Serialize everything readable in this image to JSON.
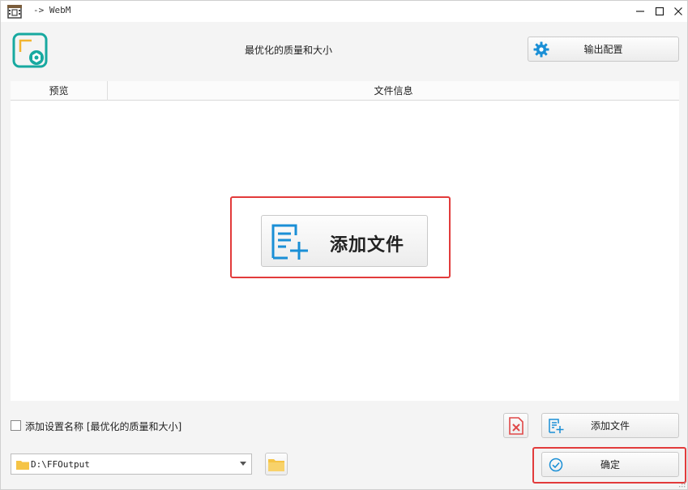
{
  "window": {
    "title": "-> WebM",
    "controls": {
      "minimize": "—",
      "maximize": "☐",
      "close": "✕"
    }
  },
  "header": {
    "preset_name": "最优化的质量和大小",
    "output_button_label": "输出配置",
    "output_button_icon": "gear-icon"
  },
  "panel": {
    "columns": [
      "预览",
      "文件信息"
    ],
    "add_big_label": "添加文件"
  },
  "bottom": {
    "checkbox_label": "添加设置名称 [最优化的质量和大小]",
    "checkbox_checked": false,
    "add_file_label": "添加文件",
    "output_path": "D:\\FFOutput",
    "ok_label": "确定"
  },
  "colors": {
    "accent": "#1a8fd6",
    "teal": "#17a9a0",
    "highlight": "#e23b3b",
    "folder": "#f5c445"
  }
}
